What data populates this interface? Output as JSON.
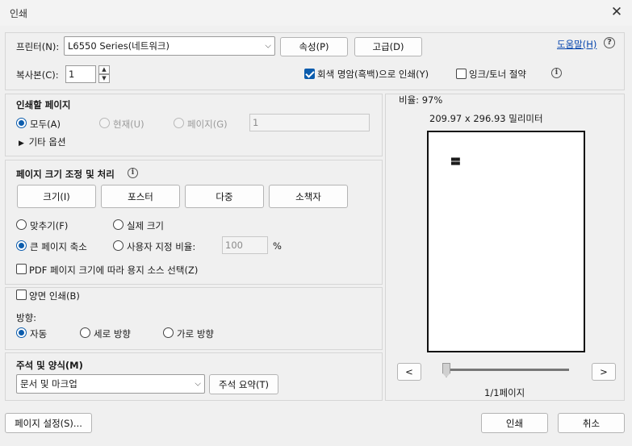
{
  "window": {
    "title": "인쇄"
  },
  "printer": {
    "label": "프린터(N):",
    "selected": "L6550 Series(네트워크)",
    "properties_btn": "속성(P)",
    "advanced_btn": "고급(D)",
    "help_link": "도움말(H)"
  },
  "copies": {
    "label": "복사본(C):",
    "value": "1",
    "grayscale_label": "회색 명암(흑백)으로 인쇄(Y)",
    "grayscale_checked": true,
    "saveink_label": "잉크/토너 절약",
    "saveink_checked": false
  },
  "pages_to_print": {
    "title": "인쇄할 페이지",
    "all": "모두(A)",
    "current": "현재(U)",
    "pages": "페이지(G)",
    "pages_value": "1",
    "more_options": "기타 옵션"
  },
  "sizing": {
    "title": "페이지 크기 조정 및 처리",
    "btn_size": "크기(I)",
    "btn_poster": "포스터",
    "btn_multiple": "다중",
    "btn_booklet": "소책자",
    "fit": "맞추기(F)",
    "actual": "실제 크기",
    "shrink": "큰 페이지 축소",
    "custom": "사용자 지정 비율:",
    "custom_value": "100",
    "percent": "%",
    "pdf_source": "PDF 페이지 크기에 따라 용지 소스 선택(Z)"
  },
  "duplex": {
    "label": "양면 인쇄(B)",
    "orientation_label": "방향:",
    "auto": "자동",
    "portrait": "세로 방향",
    "landscape": "가로 방향"
  },
  "comments": {
    "title": "주석 및 양식(M)",
    "selected": "문서 및 마크업",
    "summary_btn": "주석 요약(T)"
  },
  "preview": {
    "scale": "비율: 97%",
    "dimensions": "209.97 x 296.93 밀리미터",
    "prev": "<",
    "next": ">",
    "page_indicator": "1/1페이지"
  },
  "footer": {
    "page_setup": "페이지 설정(S)...",
    "print": "인쇄",
    "cancel": "취소"
  }
}
